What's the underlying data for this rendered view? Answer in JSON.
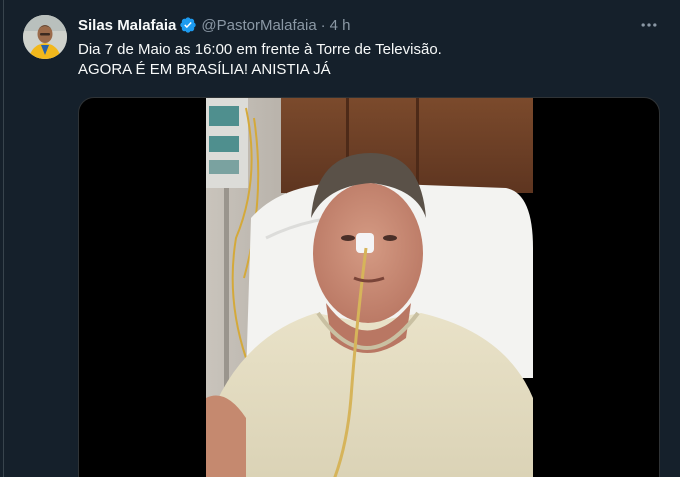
{
  "tweet": {
    "author": {
      "display_name": "Silas Malafaia",
      "handle": "@PastorMalafaia",
      "verified": true
    },
    "separator": "·",
    "time": "4 h",
    "text_lines": [
      "Dia 7 de Maio as 16:00 em frente à Torre de Televisão.",
      "AGORA É EM BRASÍLIA! ANISTIA JÁ"
    ],
    "media": {
      "type": "video"
    }
  },
  "colors": {
    "background": "#15202b",
    "text": "#f7f9f9",
    "muted": "#8b98a5",
    "verified": "#1d9bf0",
    "divider": "#38444d"
  },
  "icons": {
    "verified": "verified-badge-icon",
    "more": "more-horizontal-icon"
  }
}
